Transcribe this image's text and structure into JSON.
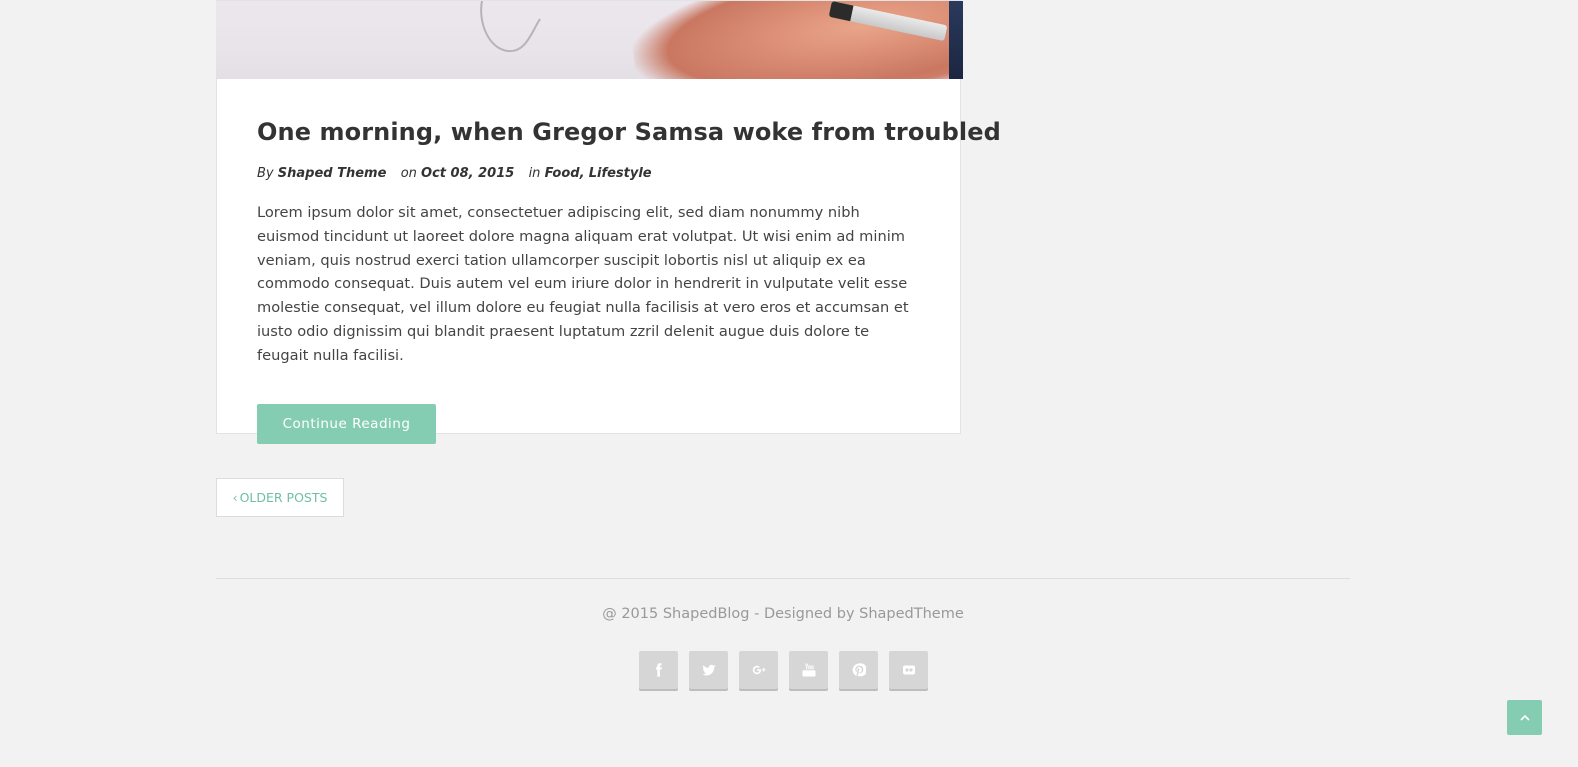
{
  "post": {
    "image": "post-featured-image",
    "title": "One morning, when Gregor Samsa woke from troubled",
    "meta": {
      "by_label": "By",
      "author": "Shaped Theme",
      "on_label": "on",
      "date": "Oct 08, 2015",
      "in_label": "in",
      "categories": [
        "Food",
        "Lifestyle"
      ],
      "separator": ","
    },
    "excerpt": "Lorem ipsum dolor sit amet, consectetuer adipiscing elit, sed diam nonummy nibh euismod tincidunt ut laoreet dolore magna aliquam erat volutpat. Ut wisi enim ad minim veniam, quis nostrud exerci tation ullamcorper suscipit lobortis nisl ut aliquip ex ea commodo consequat. Duis autem vel eum iriure dolor in hendrerit in vulputate velit esse molestie consequat, vel illum dolore eu feugiat nulla facilisis at vero eros et accumsan et iusto odio dignissim qui blandit praesent luptatum zzril delenit augue duis dolore te feugait nulla facilisi.",
    "continue_label": "Continue Reading"
  },
  "pagination": {
    "older_label": "OLDER POSTS",
    "older_icon": "chevron-left-icon"
  },
  "footer": {
    "copyright": "@ 2015 ShapedBlog - Designed by ShapedTheme",
    "social": [
      {
        "name": "facebook-icon"
      },
      {
        "name": "twitter-icon"
      },
      {
        "name": "google-plus-icon"
      },
      {
        "name": "youtube-icon"
      },
      {
        "name": "pinterest-icon"
      },
      {
        "name": "flickr-icon"
      }
    ]
  },
  "back_to_top_icon": "chevron-up-icon",
  "colors": {
    "accent": "#85cdb2",
    "link": "#6fbfa3",
    "background": "#f2f2f2",
    "social_bg": "#d6d6d6"
  }
}
